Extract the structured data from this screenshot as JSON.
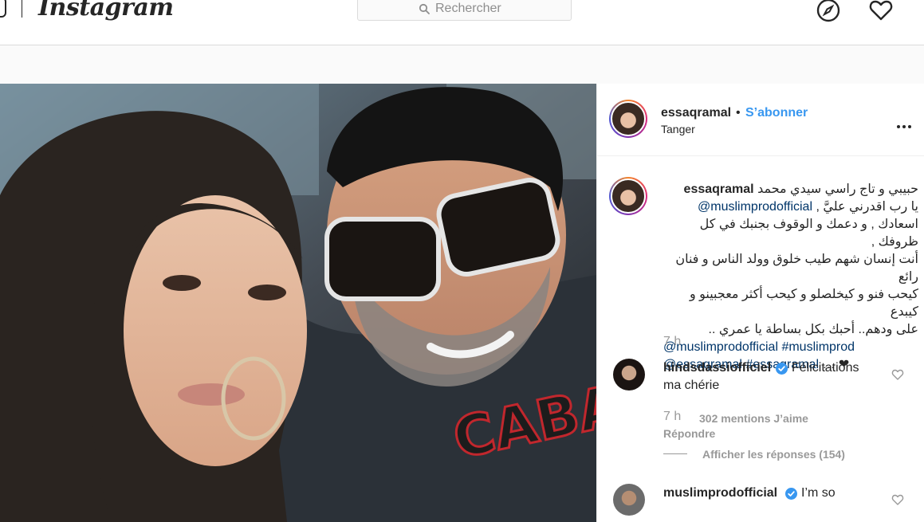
{
  "nav": {
    "logo": "Instagram",
    "search_placeholder": "Rechercher",
    "icons": [
      "search-icon",
      "compass-icon",
      "heart-icon"
    ]
  },
  "post": {
    "username": "essaqramal",
    "separator": "•",
    "follow_label": "S’abonner",
    "location": "Tanger",
    "caption": {
      "username": "essaqramal",
      "line1": "حبيبي و تاج راسي سيدي محمد",
      "line2_text": "يا رب اقدرني عليَّ ,",
      "line2_mention": "@muslimprodofficial",
      "line3": "اسعادك , و دعمك و الوقوف بجنبك في كل ظروفك ,",
      "line4": "أنت إنسان شهم طيب خلوق وولد الناس و فنان رائع",
      "line5": "كيحب فنو و كيخلصلو و كيحب أكثر معجبينو و كيبدع",
      "line6": "على ودهم.. أحبك بكل بساطة يا عمري ..",
      "tags_line1_a": "@muslimprodofficial",
      "tags_line1_b": "#muslimprod",
      "tags_line2_a": "@essaqramal",
      "tags_line2_b": "#essaqramal",
      "tags_line2_tail": "… ❤"
    },
    "caption_time": "7 h"
  },
  "comments": [
    {
      "username": "hindsdassiofficiel",
      "text_line1": "Félicitations",
      "text_line2": "ma chérie",
      "time": "7 h",
      "likes": "302 mentions J’aime",
      "reply_label": "Répondre",
      "view_replies": "Afficher les réponses (154)"
    },
    {
      "username": "muslimprodofficial",
      "text_line1": "I’m so"
    }
  ],
  "colors": {
    "link_blue": "#3897f0",
    "tag_blue": "#003569",
    "verified_blue": "#3897f0",
    "muted": "#999999"
  }
}
